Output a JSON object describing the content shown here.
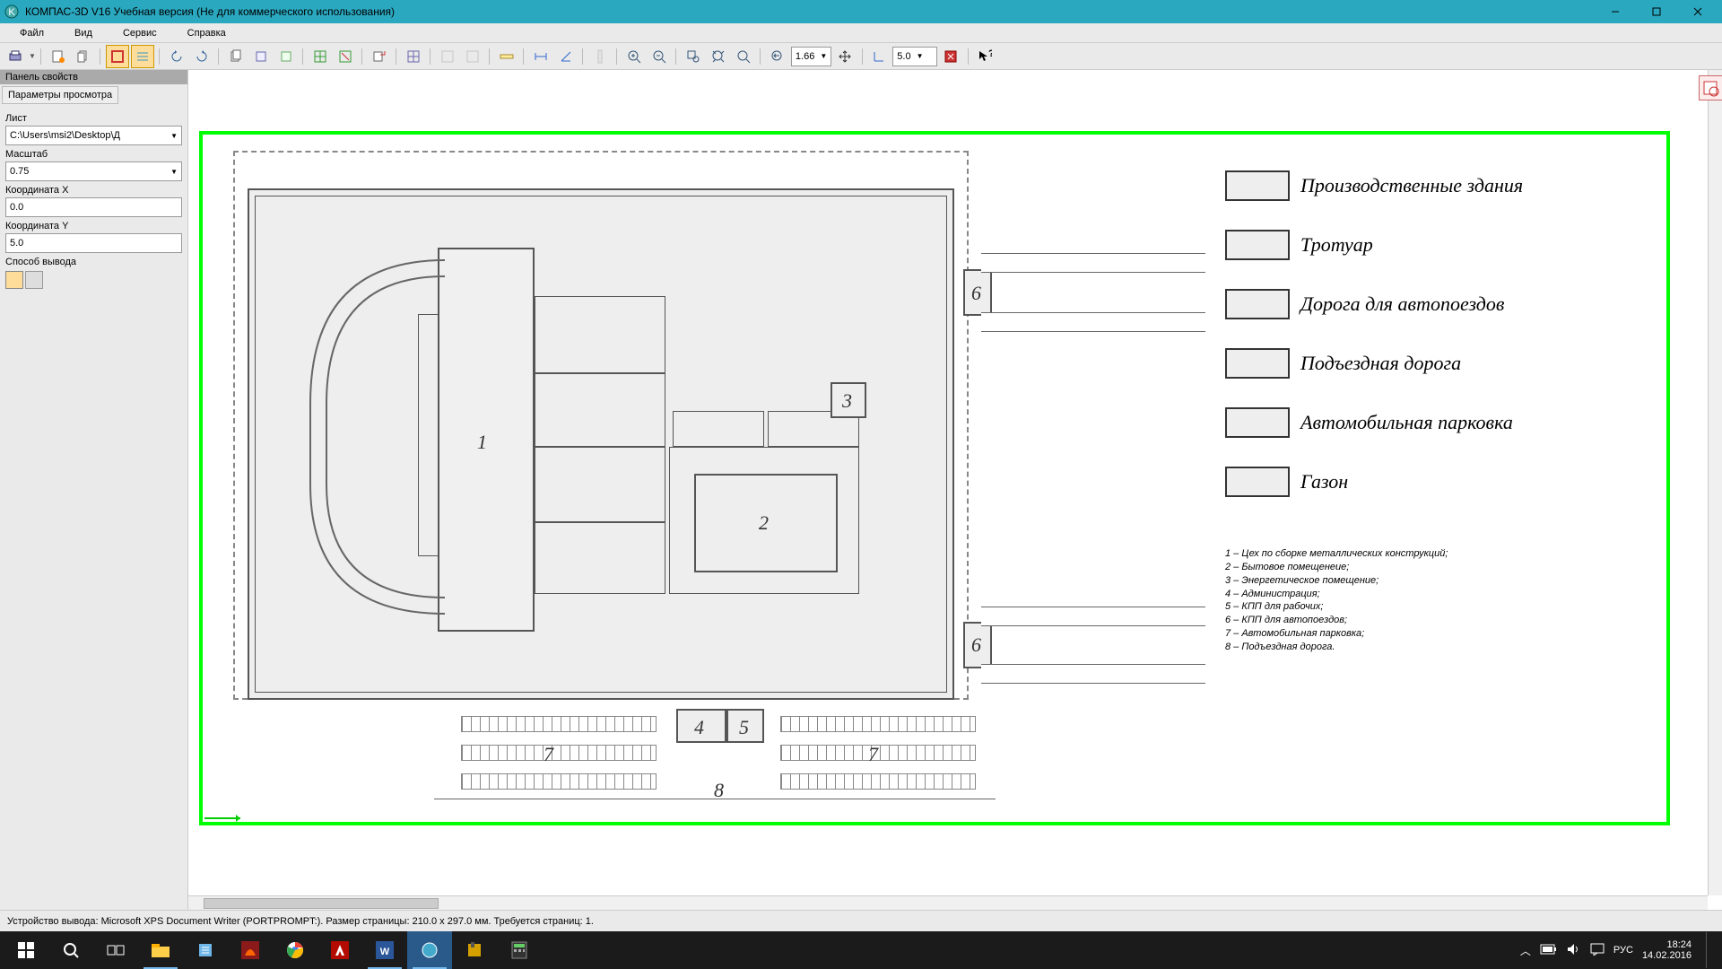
{
  "title": "КОМПАС-3D V16 Учебная версия  (Не для коммерческого использования)",
  "menu": {
    "file": "Файл",
    "view": "Вид",
    "service": "Сервис",
    "help": "Справка"
  },
  "toolbar": {
    "zoom_combo": "1.66",
    "coord_combo": "5.0"
  },
  "props": {
    "header": "Панель свойств",
    "tab": "Параметры просмотра",
    "sheet_lbl": "Лист",
    "sheet_val": "C:\\Users\\msi2\\Desktop\\Д",
    "scale_lbl": "Масштаб",
    "scale_val": "0.75",
    "cx_lbl": "Координата X",
    "cx_val": "0.0",
    "cy_lbl": "Координата Y",
    "cy_val": "5.0",
    "out_lbl": "Способ вывода"
  },
  "legend": {
    "l1": "Производственные здания",
    "l2": "Тротуар",
    "l3": "Дорога для автопоездов",
    "l4": "Подъездная дорога",
    "l5": "Автомобильная парковка",
    "l6": "Газон"
  },
  "marks": {
    "m1": "1",
    "m2": "2",
    "m3": "3",
    "m4": "4",
    "m5": "5",
    "m6a": "6",
    "m6b": "6",
    "m7a": "7",
    "m7b": "7",
    "m8": "8"
  },
  "list": {
    "i1": "1 – Цех по сборке металлических конструкций;",
    "i2": "2 – Бытовое помещенеие;",
    "i3": "3 – Энергетическое помещение;",
    "i4": "4 – Администрация;",
    "i5": "5 – КПП для рабочих;",
    "i6": "6 – КПП для автопоездов;",
    "i7": "7 – Автомобильная парковка;",
    "i8": "8 – Подъездная дорога."
  },
  "status": "Устройство вывода: Microsoft XPS Document Writer (PORTPROMPT:). Размер страницы: 210.0 x 297.0 мм. Требуется страниц: 1.",
  "tray": {
    "lang": "РУС",
    "time": "18:24",
    "date": "14.02.2016"
  }
}
